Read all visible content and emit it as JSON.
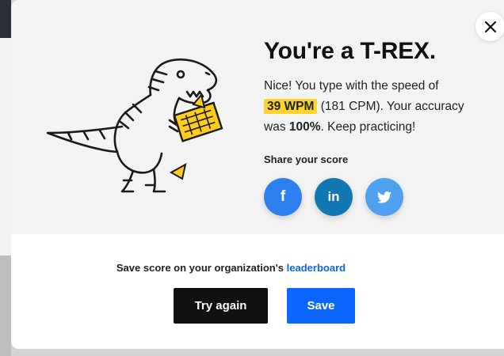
{
  "modal": {
    "title": "You're a T-REX.",
    "result": {
      "intro": "Nice! You type with the speed of",
      "wpm": "39 WPM",
      "cpm_text": "(181 CPM). Your accuracy",
      "accuracy_prefix": "was",
      "accuracy": "100%",
      "outro": ". Keep practicing!"
    },
    "share": {
      "label": "Share your score",
      "buttons": [
        {
          "icon": "facebook-icon",
          "glyph": "f",
          "color": "#2d7ff0"
        },
        {
          "icon": "linkedin-icon",
          "glyph": "in",
          "color": "#1178b3"
        },
        {
          "icon": "twitter-icon",
          "glyph": "",
          "color": "#4ea1ef"
        }
      ]
    },
    "save_prompt": {
      "text": "Save score on your organization's",
      "link": "leaderboard"
    },
    "buttons": {
      "try_again": "Try again",
      "save": "Save"
    }
  },
  "icons": {
    "close": "close-icon",
    "illustration": "t-rex-typing-illustration"
  },
  "colors": {
    "highlight": "#ffd42a",
    "primary": "#0a66ff",
    "dark_button": "#111111"
  }
}
